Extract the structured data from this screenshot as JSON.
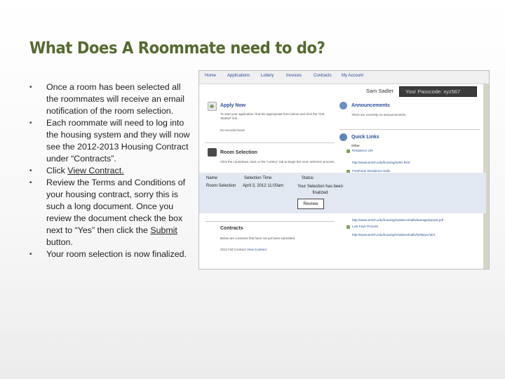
{
  "slide": {
    "title": "What Does A Roommate need to do?",
    "bullets": [
      {
        "pre": "Once a room has been selected all the roommates will receive an email notification of the room selection.",
        "link": "",
        "post": ""
      },
      {
        "pre": "Each roommate will need to log into the housing system and they will now see the 2012-2013 Housing Contract under “Contracts”.",
        "link": "",
        "post": ""
      },
      {
        "pre": "Click ",
        "link": "View Contract.",
        "post": ""
      },
      {
        "pre": "Review the Terms and Conditions of your housing contract, sorry this is such a long document.  Once you review the document check the box next to “Yes” then click the ",
        "link": "Submit",
        "post": " button."
      },
      {
        "pre": "Your room selection is now finalized.",
        "link": "",
        "post": ""
      }
    ],
    "bullet_glyph": "•"
  },
  "screenshot": {
    "nav": [
      "Home",
      "Applications",
      "Lottery",
      "Invoices",
      "Contracts",
      "My Account"
    ],
    "user_name": "Sam Sadler",
    "passcode": "Your Passcode: xyz567",
    "apply_now": {
      "title": "Apply Now",
      "text": "To start your application, find the appropriate form below and click the \"Get Started\" link.",
      "empty": "No records found"
    },
    "announcements": {
      "title": "Announcements",
      "text": "There are currently no announcements"
    },
    "quick_links": {
      "title": "Quick Links",
      "subtitle": "Other",
      "links": [
        "Residence Life",
        "http://www.wmich.edu/housing/index.html",
        "Freshman Residence Halls",
        "http://www.wmich.edu/housing/residencehalls/freshmanhalls.html",
        "Freshman Move-In Schedule",
        "http://www.wmich.edu/housing/residencehalls/movein/freshmanmoveinschedule.php",
        "Room Damage Deposit Form",
        "http://www.wmich.edu/housing/residencehalls/damagedeposit.pdf",
        "Lost Keys Process",
        "http://www.wmich.edu/housing/residencehalls/lostkeys.html"
      ]
    },
    "room_selection": {
      "title": "Room Selection",
      "text": "Click the countdown clock or the \"Lottery\" tab to begin the room selection process.",
      "col_name": "Name",
      "col_time": "Selection Time",
      "col_status": "Status",
      "row_name": "Room Selection",
      "row_time": "April 3, 2012 11:00am",
      "row_status": "Your Selection has been finalized",
      "review_label": "Review"
    },
    "contracts": {
      "title": "Contracts",
      "text": "Below are contracts that have not yet been submitted.",
      "row": "2012 Fall Contract",
      "row_link": "View Contract"
    }
  },
  "colors": {
    "title": "#556b2f",
    "link_blue": "#2a4d9b",
    "band": "#e2e8f1",
    "passbox": "#3b3b3b"
  }
}
